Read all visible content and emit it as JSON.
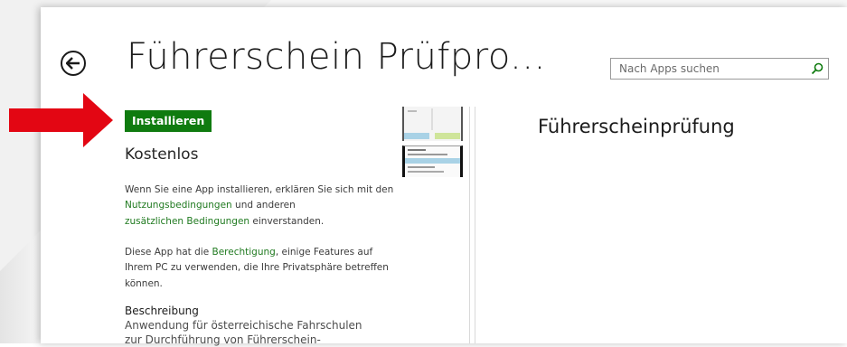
{
  "header": {
    "title": "Führerschein Prüfpro...",
    "back_icon": "back-arrow-icon"
  },
  "search": {
    "placeholder": "Nach Apps suchen",
    "icon": "search-icon"
  },
  "app": {
    "install_label": "Installieren",
    "price": "Kostenlos",
    "terms_line1": "Wenn Sie eine App installieren, erklären Sie sich mit den",
    "terms_link1": "Nutzungsbedingungen",
    "terms_line2_rest": " und anderen",
    "terms_link2": "zusätzlichen Bedingungen",
    "terms_line3_rest": " einverstanden.",
    "perm_prefix": "Diese App hat die ",
    "perm_link": "Berechtigung",
    "perm_suffix": ", einige Features auf",
    "perm_line2": "Ihrem PC zu verwenden, die Ihre Privatsphäre betreffen",
    "perm_line3": "können.",
    "description_heading": "Beschreibung",
    "description_line1": "Anwendung für österreichische Fahrschulen",
    "description_line2": "zur Durchführung von Führerschein-"
  },
  "screenshot": {
    "heading": "Führerscheinprüfung"
  },
  "colors": {
    "install_green": "#0f7b0f",
    "link_green": "#207a20",
    "annotation_red": "#e30613"
  }
}
